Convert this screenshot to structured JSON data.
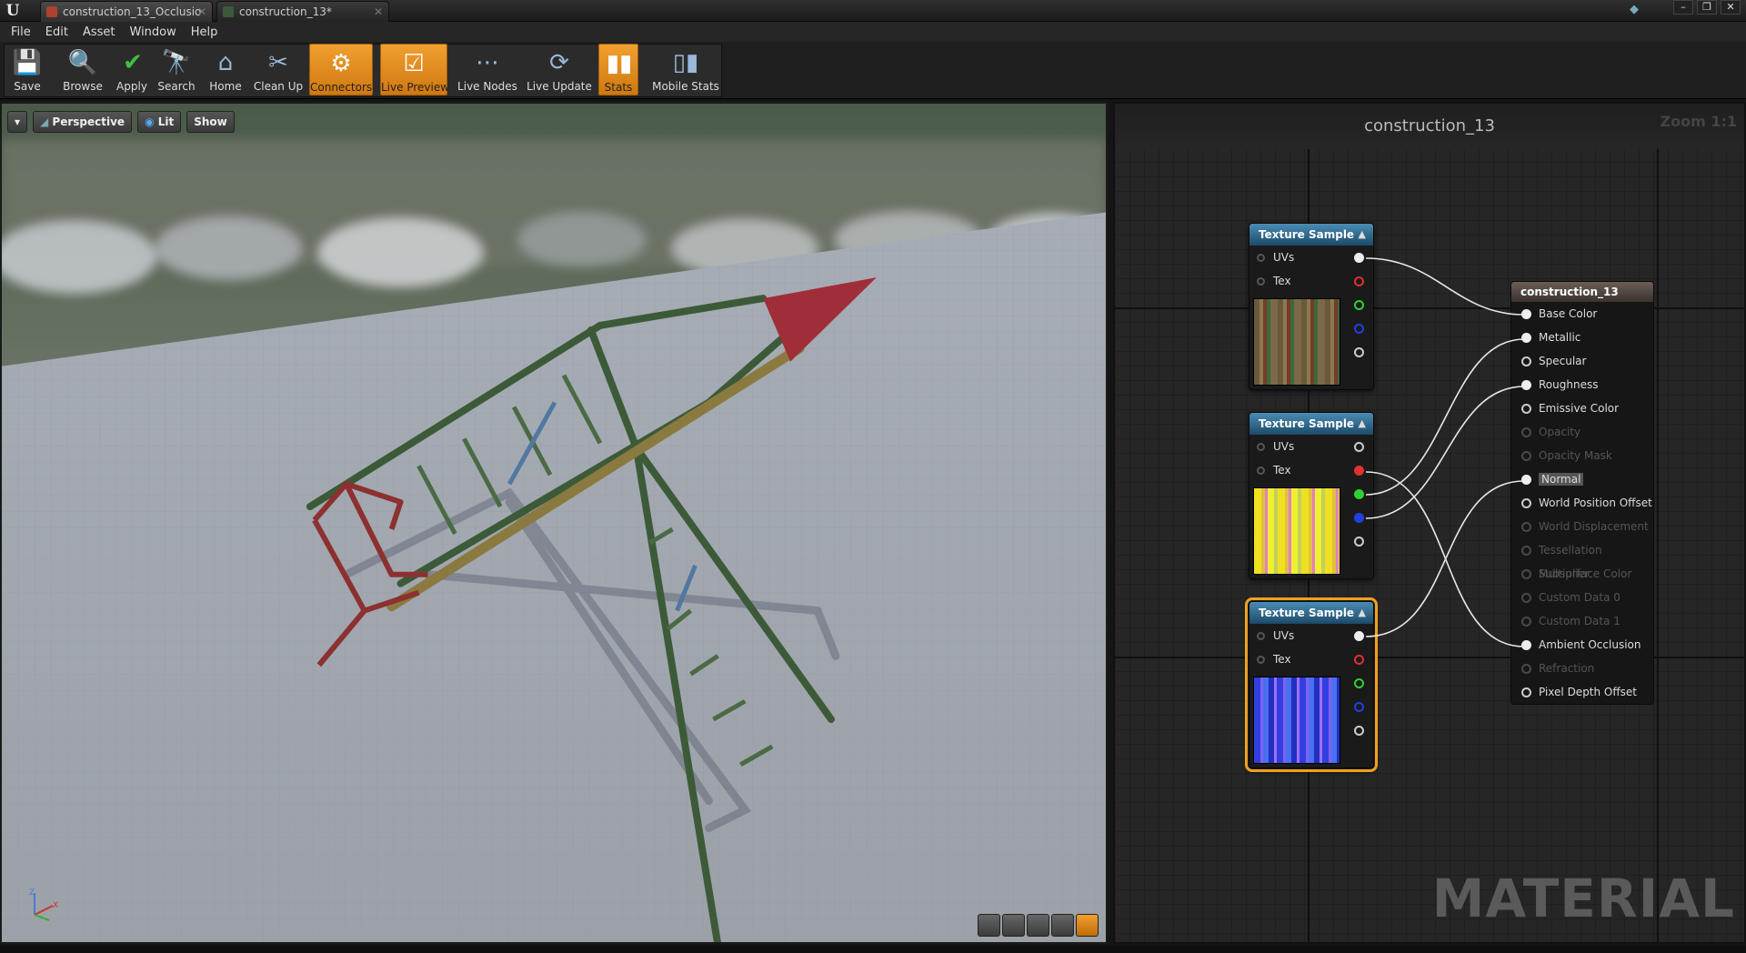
{
  "tabs": [
    {
      "label": "construction_13_Occlusio",
      "icon": "texture-icon",
      "active": false
    },
    {
      "label": "construction_13*",
      "icon": "material-icon",
      "active": true
    }
  ],
  "menu": [
    "File",
    "Edit",
    "Asset",
    "Window",
    "Help"
  ],
  "toolbar": {
    "buttons": [
      {
        "label": "Save",
        "icon": "save-icon",
        "on": false
      },
      {
        "label": "Browse",
        "icon": "browse-icon",
        "on": false
      },
      {
        "label": "Apply",
        "icon": "apply-icon",
        "on": false
      },
      {
        "label": "Search",
        "icon": "search-icon",
        "on": false
      },
      {
        "label": "Home",
        "icon": "home-icon",
        "on": false
      },
      {
        "label": "Clean Up",
        "icon": "broom-icon",
        "on": false
      },
      {
        "label": "Connectors",
        "icon": "connectors-icon",
        "on": true
      },
      {
        "label": "Live Preview",
        "icon": "live-preview-icon",
        "on": true
      },
      {
        "label": "Live Nodes",
        "icon": "live-nodes-icon",
        "on": false
      },
      {
        "label": "Live Update",
        "icon": "live-update-icon",
        "on": false
      },
      {
        "label": "Stats",
        "icon": "stats-icon",
        "on": true
      },
      {
        "label": "Mobile Stats",
        "icon": "mobile-stats-icon",
        "on": false
      }
    ]
  },
  "viewport": {
    "perspective": "Perspective",
    "lit": "Lit",
    "show": "Show"
  },
  "graph": {
    "title": "construction_13",
    "zoom": "Zoom 1:1",
    "watermark": "MATERIAL"
  },
  "texture_nodes": [
    {
      "title": "Texture Sample",
      "uvs": "UVs",
      "tex": "Tex",
      "selected": false
    },
    {
      "title": "Texture Sample",
      "uvs": "UVs",
      "tex": "Tex",
      "selected": false
    },
    {
      "title": "Texture Sample",
      "uvs": "UVs",
      "tex": "Tex",
      "selected": true
    }
  ],
  "result_node": {
    "title": "construction_13",
    "pins": [
      {
        "label": "Base Color",
        "enabled": true,
        "connected": true
      },
      {
        "label": "Metallic",
        "enabled": true,
        "connected": true
      },
      {
        "label": "Specular",
        "enabled": true,
        "connected": false
      },
      {
        "label": "Roughness",
        "enabled": true,
        "connected": true
      },
      {
        "label": "Emissive Color",
        "enabled": true,
        "connected": false
      },
      {
        "label": "Opacity",
        "enabled": false,
        "connected": false
      },
      {
        "label": "Opacity Mask",
        "enabled": false,
        "connected": false
      },
      {
        "label": "Normal",
        "enabled": true,
        "connected": true
      },
      {
        "label": "World Position Offset",
        "enabled": true,
        "connected": false
      },
      {
        "label": "World Displacement",
        "enabled": false,
        "connected": false
      },
      {
        "label": "Tessellation Multiplier",
        "enabled": false,
        "connected": false
      },
      {
        "label": "Subsurface Color",
        "enabled": false,
        "connected": false
      },
      {
        "label": "Custom Data 0",
        "enabled": false,
        "connected": false
      },
      {
        "label": "Custom Data 1",
        "enabled": false,
        "connected": false
      },
      {
        "label": "Ambient Occlusion",
        "enabled": true,
        "connected": true
      },
      {
        "label": "Refraction",
        "enabled": false,
        "connected": false
      },
      {
        "label": "Pixel Depth Offset",
        "enabled": true,
        "connected": false
      }
    ]
  },
  "colors": {
    "accent": "#f0a020",
    "node_header": "#2a6a94",
    "result_header": "#5a4e48"
  }
}
